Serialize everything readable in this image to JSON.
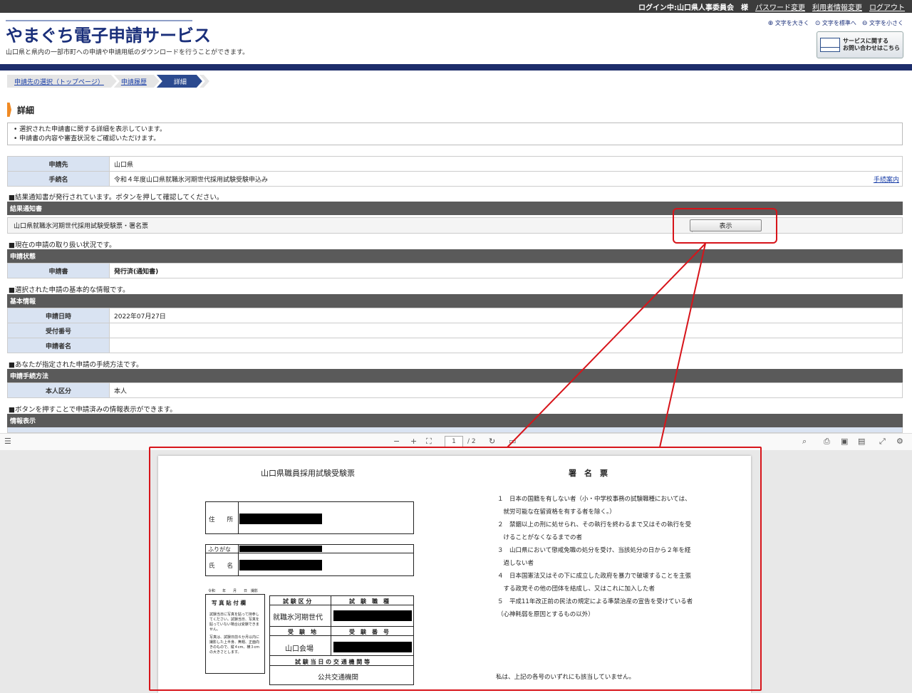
{
  "topbar": {
    "login": "ログイン中:山口県人事委員会　様",
    "links": [
      "パスワード変更",
      "利用者情報変更",
      "ログアウト"
    ]
  },
  "header": {
    "logo_kana": "やまぐち",
    "logo_rest": "電子申請サービス",
    "tagline": "山口県と県内の一部市町への申請や申請用紙のダウンロードを行うことができます。",
    "font_controls": [
      "文字を大きく",
      "文字を標準へ",
      "文字を小さく"
    ],
    "inquiry_line1": "サービスに関する",
    "inquiry_line2": "お問い合わせはこちら"
  },
  "breadcrumb": [
    "申請先の選択（トップページ）",
    "申請履歴",
    "詳細"
  ],
  "page_title": "詳細",
  "info": [
    "選択された申請書に関する詳細を表示しています。",
    "申請書の内容や審査状況をご確認いただけます。"
  ],
  "summary": {
    "dest_label": "申請先",
    "dest_value": "山口県",
    "proc_label": "手続名",
    "proc_value": "令和４年度山口県就職氷河期世代採用試験受験申込み",
    "guide_link": "手続案内"
  },
  "notes": {
    "result": "■結果通知書が発行されています。ボタンを押して確認してください。",
    "status": "■現在の申請の取り扱い状況です。",
    "basic": "■選択された申請の基本的な情報です。",
    "method": "■あなたが指定された申請の手続方法です。",
    "display": "■ボタンを押すことで申請済みの情報表示ができます。"
  },
  "result_section": {
    "header": "結果通知書",
    "doc_name": "山口県就職氷河期世代採用試験受験票・署名票",
    "button": "表示"
  },
  "status_section": {
    "header": "申請状態",
    "label": "申請書",
    "value": "発行済(通知書)"
  },
  "basic_section": {
    "header": "基本情報",
    "rows": [
      {
        "label": "申請日時",
        "value": "2022年07月27日"
      },
      {
        "label": "受付番号",
        "value": ""
      },
      {
        "label": "申請者名",
        "value": ""
      }
    ]
  },
  "method_section": {
    "header": "申請手続方法",
    "label": "本人区分",
    "value": "本人"
  },
  "display_section": {
    "header": "情報表示"
  },
  "pdf_toolbar": {
    "minus": "−",
    "plus": "+",
    "page": "1",
    "total": "/ 2"
  },
  "pdf": {
    "exam_title": "山口県職員採用試験受験票",
    "sign_title": "署　名　票",
    "address_label": "住　　所",
    "furigana_label": "ふりがな",
    "name_label": "氏　　名",
    "date_label": "令和　　年　　月　　日　撮影",
    "photo_label": "写 真 貼 付 欄",
    "photo_note1": "試験当日に写真を貼って持参してください。試験当日、写真を貼っていない場合は受験できません。",
    "photo_note2": "写真は、試験日前６か月以内に撮影した上半身、無帽、正面向きのもので、縦４cm、横３cmの大きさとします。",
    "cat_label": "試 験 区 分",
    "job_label": "試　験　職　種",
    "cat_value": "就職氷河期世代",
    "site_label": "受　験　地",
    "num_label": "受　験　番　号",
    "site_value": "山口会場",
    "transport_label": "試 験 当 日 の 交 通 機 関 等",
    "transport_value": "公共交通機関",
    "sign_items": [
      "１　日本の国籍を有しない者（小・中学校事務の試験職種においては、",
      "　就労可能な在留資格を有する者を除く。）",
      "２　禁錮以上の刑に処せられ、その執行を終わるまで又はその執行を受",
      "　けることがなくなるまでの者",
      "３　山口県において懲戒免職の処分を受け、当該処分の日から２年を経",
      "　過しない者",
      "４　日本国憲法又はその下に成立した政府を暴力で破壊することを主張",
      "　する政党その他の団体を結成し、又はこれに加入した者",
      "５　平成11年改正前の民法の規定による準禁治産の宣告を受けている者",
      "（心神耗弱を原因とするもの以外）"
    ],
    "sign_footer": "私は、上記の各号のいずれにも該当していません。"
  },
  "colors": {
    "navy": "#1d2d6b",
    "annotation_red": "#d7141a",
    "section_gray": "#5a5a5a",
    "label_blue": "#d9e3f2"
  }
}
